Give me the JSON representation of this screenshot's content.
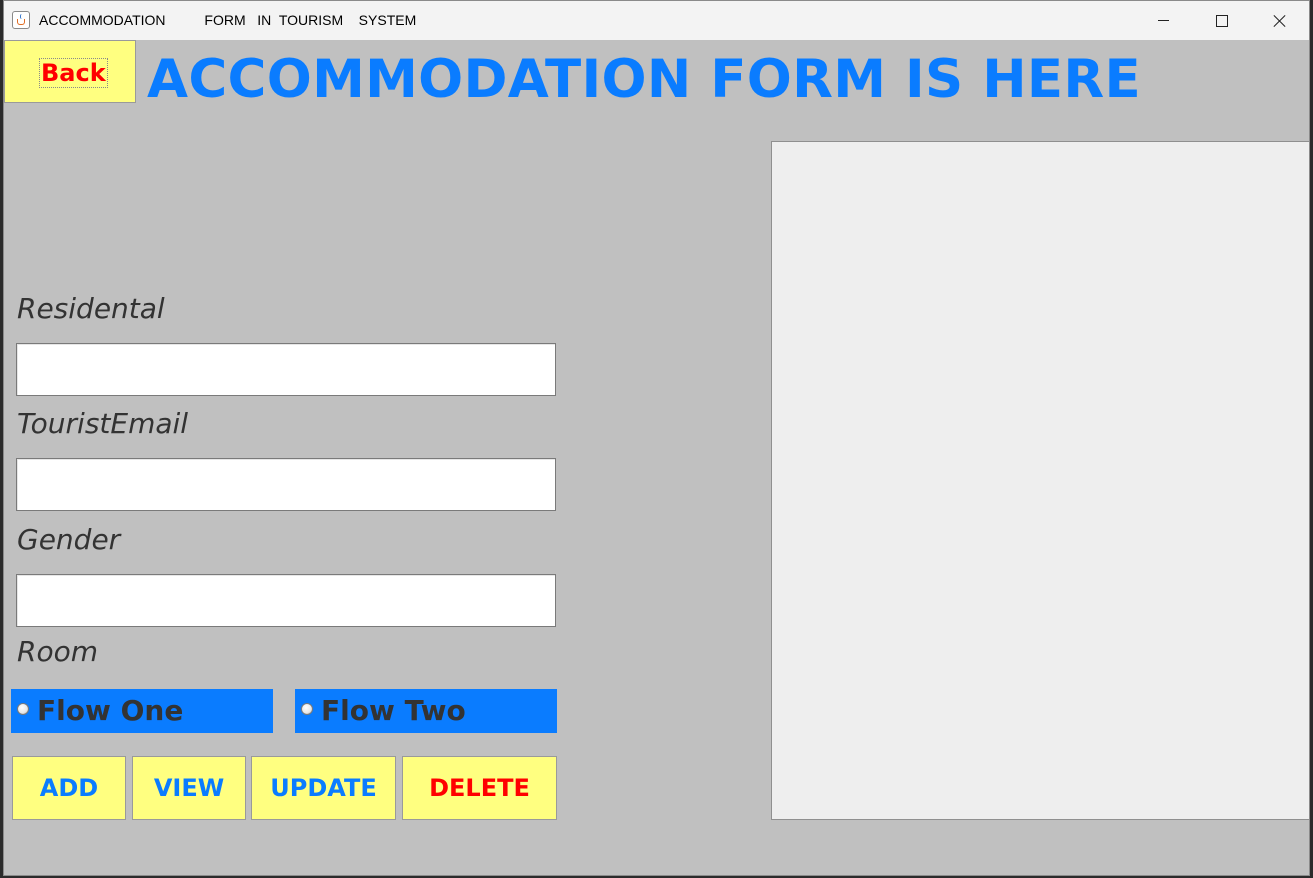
{
  "window": {
    "title": "ACCOMMODATION          FORM   IN  TOURISM    SYSTEM",
    "icon": "java-cup-icon",
    "controls": [
      "minimize",
      "maximize",
      "close"
    ]
  },
  "header": {
    "back_label": "Back",
    "title": "ACCOMMODATION FORM IS HERE"
  },
  "form": {
    "residental_label": "Residental",
    "residental_value": "",
    "tourist_email_label": "TouristEmail",
    "tourist_email_value": "",
    "gender_label": "Gender",
    "gender_value": "",
    "room_label": "Room",
    "room_options": [
      {
        "label": "Flow One",
        "selected": false
      },
      {
        "label": "Flow Two",
        "selected": false
      }
    ]
  },
  "actions": {
    "add_label": "ADD",
    "view_label": "VIEW",
    "update_label": "UPDATE",
    "delete_label": "DELETE"
  },
  "table": {
    "rows": []
  },
  "colors": {
    "background": "#c0c0c0",
    "accent_blue": "#0a7cff",
    "button_yellow": "#ffff80",
    "danger_red": "#ff0000",
    "label_gray": "#333333",
    "table_bg": "#eeeeee"
  }
}
